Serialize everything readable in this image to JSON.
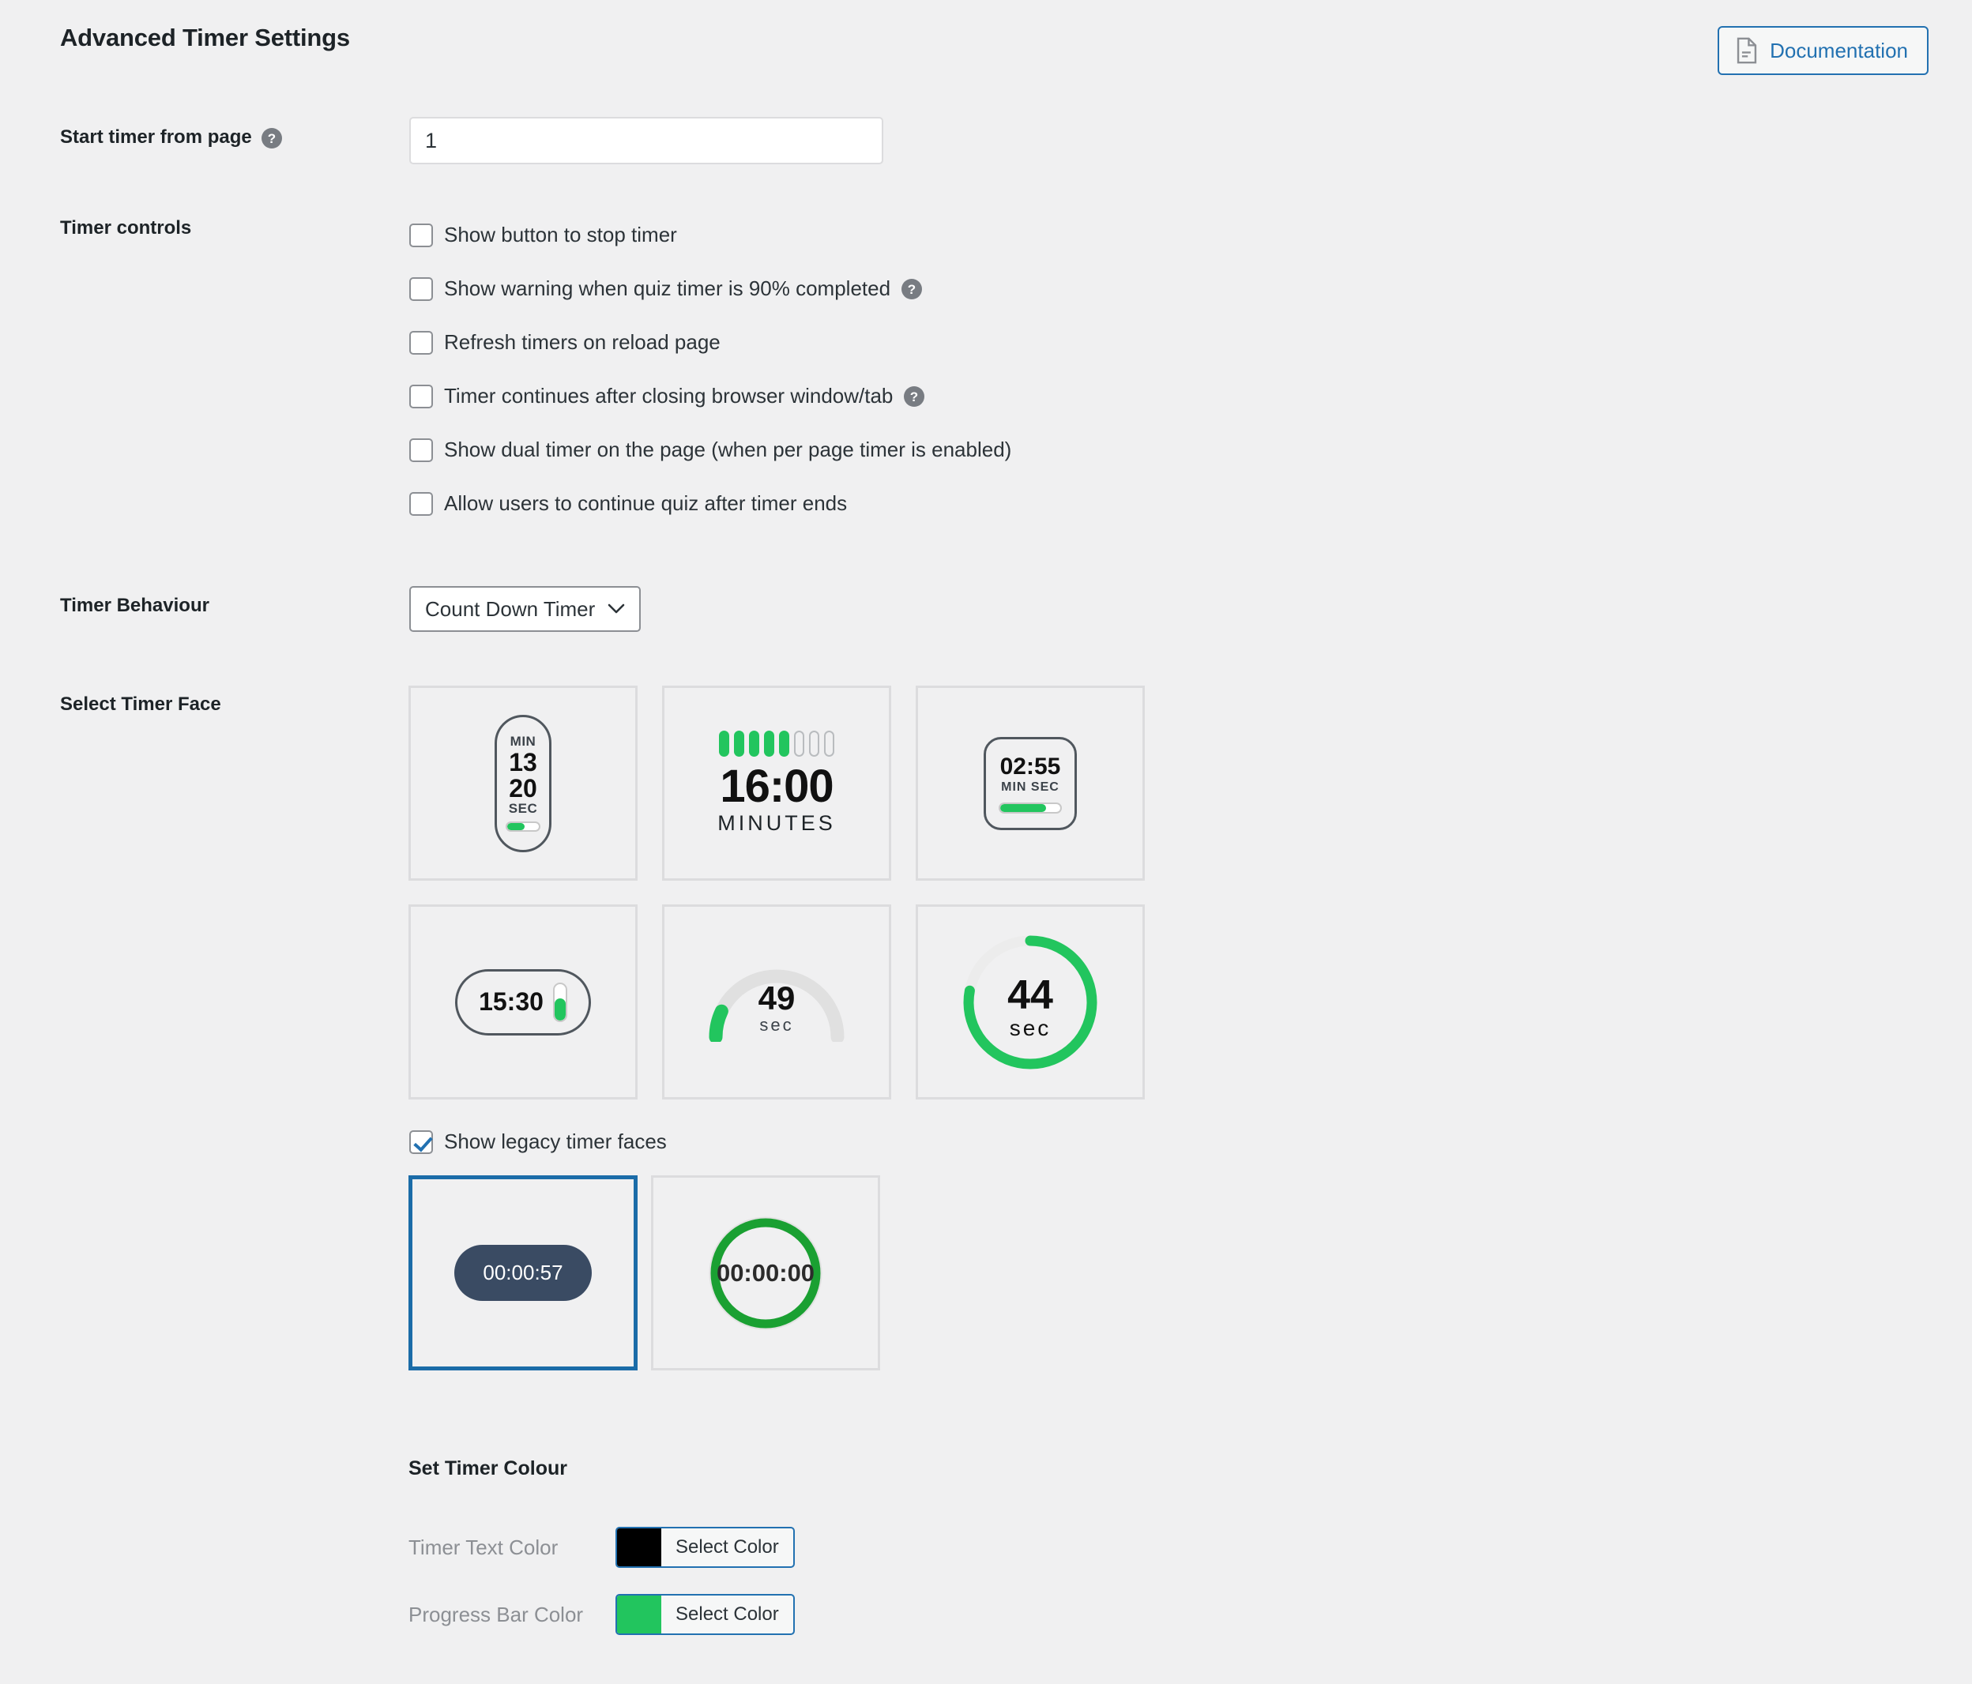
{
  "header": {
    "title": "Advanced Timer Settings",
    "documentation_label": "Documentation",
    "documentation_icon": "document-icon",
    "accent_blue": "#2271b1"
  },
  "start_timer": {
    "label": "Start timer from page",
    "help_icon": "help-icon",
    "value": "1"
  },
  "timer_controls": {
    "label": "Timer controls",
    "items": [
      {
        "label": "Show button to stop timer",
        "checked": false,
        "help": false
      },
      {
        "label": "Show warning when quiz timer is 90% completed",
        "checked": false,
        "help": true
      },
      {
        "label": "Refresh timers on reload page",
        "checked": false,
        "help": false
      },
      {
        "label": "Timer continues after closing browser window/tab",
        "checked": false,
        "help": true
      },
      {
        "label": "Show dual timer on the page (when per page timer is enabled)",
        "checked": false,
        "help": false
      },
      {
        "label": "Allow users to continue quiz after timer ends",
        "checked": false,
        "help": false
      }
    ]
  },
  "timer_behaviour": {
    "label": "Timer Behaviour",
    "selected": "Count Down Timer"
  },
  "select_timer_face": {
    "label": "Select Timer Face",
    "faces": [
      {
        "id": "band-vertical",
        "min_unit": "MIN",
        "minutes": "13",
        "seconds": "20",
        "sec_unit": "SEC",
        "progress_pct": 55
      },
      {
        "id": "segments",
        "time": "16:00",
        "unit": "MINUTES",
        "segments_on": 5,
        "segments_off": 3
      },
      {
        "id": "rounded-square",
        "time": "02:55",
        "units": "MIN  SEC",
        "progress_pct": 76
      },
      {
        "id": "pill-battery",
        "time": "15:30",
        "progress_pct": 60
      },
      {
        "id": "gauge-arc",
        "number": "49",
        "unit": "sec",
        "progress_pct": 14
      },
      {
        "id": "ring",
        "number": "44",
        "unit": "sec",
        "progress_pct": 78
      }
    ]
  },
  "legacy": {
    "checkbox_label": "Show legacy timer faces",
    "checked": true,
    "faces": [
      {
        "id": "legacy-pill",
        "time": "00:00:57",
        "selected": true
      },
      {
        "id": "legacy-ring",
        "time": "00:00:00",
        "selected": false
      }
    ]
  },
  "timer_colour": {
    "heading": "Set Timer Colour",
    "rows": [
      {
        "label": "Timer Text Color",
        "swatch": "#000000",
        "button_label": "Select Color"
      },
      {
        "label": "Progress Bar Color",
        "swatch": "#22c55e",
        "button_label": "Select Color"
      }
    ]
  },
  "colors": {
    "green": "#22c55e",
    "background": "#f0f0f1",
    "border": "#dcdcde",
    "selected_border": "#1b6ca8",
    "legacy_pill_bg": "#3a4b63",
    "legacy_ring_green": "#1aa032"
  }
}
